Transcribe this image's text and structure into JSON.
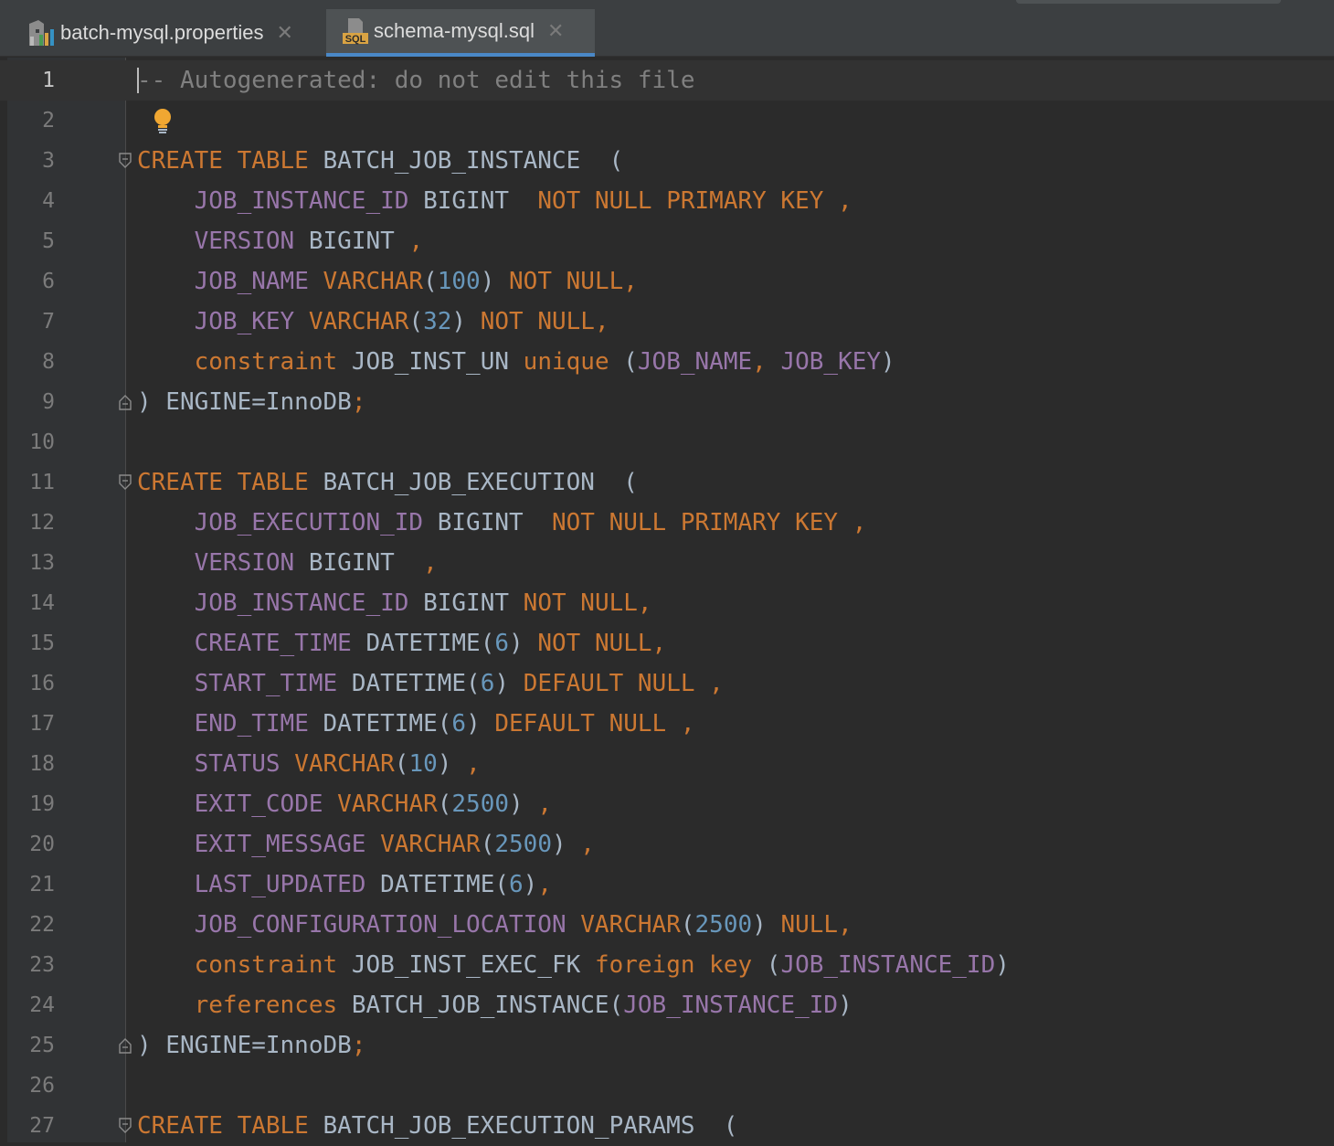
{
  "tabs": [
    {
      "label": "batch-mysql.properties",
      "icon": "properties-file-icon",
      "active": false
    },
    {
      "label": "schema-mysql.sql",
      "icon": "sql-file-icon",
      "active": true
    }
  ],
  "sql_icon_text": "SQL",
  "close_glyph": "✕",
  "colors": {
    "keyword": "#cc7832",
    "column": "#9876aa",
    "number": "#6897bb",
    "identifier": "#a9b7c6",
    "comment": "#808080",
    "background": "#2b2b2b",
    "gutter": "#313335",
    "active_tab_underline": "#4a88c7"
  },
  "editor": {
    "current_line": 1,
    "lines": [
      {
        "n": "1",
        "tokens": [
          {
            "t": "-- Autogenerated: do not edit this file",
            "c": "cmt"
          }
        ]
      },
      {
        "n": "2",
        "tokens": []
      },
      {
        "n": "3",
        "fold": "open",
        "tokens": [
          {
            "t": "CREATE TABLE ",
            "c": "kw"
          },
          {
            "t": "BATCH_JOB_INSTANCE  (",
            "c": "plain"
          }
        ]
      },
      {
        "n": "4",
        "tokens": [
          {
            "t": "    ",
            "c": "plain"
          },
          {
            "t": "JOB_INSTANCE_ID",
            "c": "col"
          },
          {
            "t": " BIGINT  ",
            "c": "plain"
          },
          {
            "t": "NOT NULL PRIMARY KEY ,",
            "c": "kw"
          }
        ]
      },
      {
        "n": "5",
        "tokens": [
          {
            "t": "    ",
            "c": "plain"
          },
          {
            "t": "VERSION",
            "c": "col"
          },
          {
            "t": " BIGINT ",
            "c": "plain"
          },
          {
            "t": ",",
            "c": "kw"
          }
        ]
      },
      {
        "n": "6",
        "tokens": [
          {
            "t": "    ",
            "c": "plain"
          },
          {
            "t": "JOB_NAME",
            "c": "col"
          },
          {
            "t": " ",
            "c": "plain"
          },
          {
            "t": "VARCHAR",
            "c": "kw"
          },
          {
            "t": "(",
            "c": "plain"
          },
          {
            "t": "100",
            "c": "num"
          },
          {
            "t": ") ",
            "c": "plain"
          },
          {
            "t": "NOT NULL,",
            "c": "kw"
          }
        ]
      },
      {
        "n": "7",
        "tokens": [
          {
            "t": "    ",
            "c": "plain"
          },
          {
            "t": "JOB_KEY",
            "c": "col"
          },
          {
            "t": " ",
            "c": "plain"
          },
          {
            "t": "VARCHAR",
            "c": "kw"
          },
          {
            "t": "(",
            "c": "plain"
          },
          {
            "t": "32",
            "c": "num"
          },
          {
            "t": ") ",
            "c": "plain"
          },
          {
            "t": "NOT NULL,",
            "c": "kw"
          }
        ]
      },
      {
        "n": "8",
        "tokens": [
          {
            "t": "    ",
            "c": "plain"
          },
          {
            "t": "constraint",
            "c": "kw"
          },
          {
            "t": " JOB_INST_UN ",
            "c": "plain"
          },
          {
            "t": "unique",
            "c": "kw"
          },
          {
            "t": " (",
            "c": "plain"
          },
          {
            "t": "JOB_NAME",
            "c": "col"
          },
          {
            "t": ", ",
            "c": "kw"
          },
          {
            "t": "JOB_KEY",
            "c": "col"
          },
          {
            "t": ")",
            "c": "plain"
          }
        ]
      },
      {
        "n": "9",
        "fold": "close",
        "tokens": [
          {
            "t": ") ENGINE=InnoDB",
            "c": "plain"
          },
          {
            "t": ";",
            "c": "kw"
          }
        ]
      },
      {
        "n": "10",
        "tokens": []
      },
      {
        "n": "11",
        "fold": "open",
        "tokens": [
          {
            "t": "CREATE TABLE ",
            "c": "kw"
          },
          {
            "t": "BATCH_JOB_EXECUTION  (",
            "c": "plain"
          }
        ]
      },
      {
        "n": "12",
        "tokens": [
          {
            "t": "    ",
            "c": "plain"
          },
          {
            "t": "JOB_EXECUTION_ID",
            "c": "col"
          },
          {
            "t": " BIGINT  ",
            "c": "plain"
          },
          {
            "t": "NOT NULL PRIMARY KEY ,",
            "c": "kw"
          }
        ]
      },
      {
        "n": "13",
        "tokens": [
          {
            "t": "    ",
            "c": "plain"
          },
          {
            "t": "VERSION",
            "c": "col"
          },
          {
            "t": " BIGINT  ",
            "c": "plain"
          },
          {
            "t": ",",
            "c": "kw"
          }
        ]
      },
      {
        "n": "14",
        "tokens": [
          {
            "t": "    ",
            "c": "plain"
          },
          {
            "t": "JOB_INSTANCE_ID",
            "c": "col"
          },
          {
            "t": " BIGINT ",
            "c": "plain"
          },
          {
            "t": "NOT NULL,",
            "c": "kw"
          }
        ]
      },
      {
        "n": "15",
        "tokens": [
          {
            "t": "    ",
            "c": "plain"
          },
          {
            "t": "CREATE_TIME",
            "c": "col"
          },
          {
            "t": " DATETIME(",
            "c": "plain"
          },
          {
            "t": "6",
            "c": "num"
          },
          {
            "t": ") ",
            "c": "plain"
          },
          {
            "t": "NOT NULL,",
            "c": "kw"
          }
        ]
      },
      {
        "n": "16",
        "tokens": [
          {
            "t": "    ",
            "c": "plain"
          },
          {
            "t": "START_TIME",
            "c": "col"
          },
          {
            "t": " DATETIME(",
            "c": "plain"
          },
          {
            "t": "6",
            "c": "num"
          },
          {
            "t": ") ",
            "c": "plain"
          },
          {
            "t": "DEFAULT NULL ,",
            "c": "kw"
          }
        ]
      },
      {
        "n": "17",
        "tokens": [
          {
            "t": "    ",
            "c": "plain"
          },
          {
            "t": "END_TIME",
            "c": "col"
          },
          {
            "t": " DATETIME(",
            "c": "plain"
          },
          {
            "t": "6",
            "c": "num"
          },
          {
            "t": ") ",
            "c": "plain"
          },
          {
            "t": "DEFAULT NULL ,",
            "c": "kw"
          }
        ]
      },
      {
        "n": "18",
        "tokens": [
          {
            "t": "    ",
            "c": "plain"
          },
          {
            "t": "STATUS",
            "c": "col"
          },
          {
            "t": " ",
            "c": "plain"
          },
          {
            "t": "VARCHAR",
            "c": "kw"
          },
          {
            "t": "(",
            "c": "plain"
          },
          {
            "t": "10",
            "c": "num"
          },
          {
            "t": ") ",
            "c": "plain"
          },
          {
            "t": ",",
            "c": "kw"
          }
        ]
      },
      {
        "n": "19",
        "tokens": [
          {
            "t": "    ",
            "c": "plain"
          },
          {
            "t": "EXIT_CODE",
            "c": "col"
          },
          {
            "t": " ",
            "c": "plain"
          },
          {
            "t": "VARCHAR",
            "c": "kw"
          },
          {
            "t": "(",
            "c": "plain"
          },
          {
            "t": "2500",
            "c": "num"
          },
          {
            "t": ") ",
            "c": "plain"
          },
          {
            "t": ",",
            "c": "kw"
          }
        ]
      },
      {
        "n": "20",
        "tokens": [
          {
            "t": "    ",
            "c": "plain"
          },
          {
            "t": "EXIT_MESSAGE",
            "c": "col"
          },
          {
            "t": " ",
            "c": "plain"
          },
          {
            "t": "VARCHAR",
            "c": "kw"
          },
          {
            "t": "(",
            "c": "plain"
          },
          {
            "t": "2500",
            "c": "num"
          },
          {
            "t": ") ",
            "c": "plain"
          },
          {
            "t": ",",
            "c": "kw"
          }
        ]
      },
      {
        "n": "21",
        "tokens": [
          {
            "t": "    ",
            "c": "plain"
          },
          {
            "t": "LAST_UPDATED",
            "c": "col"
          },
          {
            "t": " DATETIME(",
            "c": "plain"
          },
          {
            "t": "6",
            "c": "num"
          },
          {
            "t": ")",
            "c": "plain"
          },
          {
            "t": ",",
            "c": "kw"
          }
        ]
      },
      {
        "n": "22",
        "tokens": [
          {
            "t": "    ",
            "c": "plain"
          },
          {
            "t": "JOB_CONFIGURATION_LOCATION",
            "c": "col"
          },
          {
            "t": " ",
            "c": "plain"
          },
          {
            "t": "VARCHAR",
            "c": "kw"
          },
          {
            "t": "(",
            "c": "plain"
          },
          {
            "t": "2500",
            "c": "num"
          },
          {
            "t": ") ",
            "c": "plain"
          },
          {
            "t": "NULL,",
            "c": "kw"
          }
        ]
      },
      {
        "n": "23",
        "tokens": [
          {
            "t": "    ",
            "c": "plain"
          },
          {
            "t": "constraint",
            "c": "kw"
          },
          {
            "t": " JOB_INST_EXEC_FK ",
            "c": "plain"
          },
          {
            "t": "foreign key",
            "c": "kw"
          },
          {
            "t": " (",
            "c": "plain"
          },
          {
            "t": "JOB_INSTANCE_ID",
            "c": "col"
          },
          {
            "t": ")",
            "c": "plain"
          }
        ]
      },
      {
        "n": "24",
        "tokens": [
          {
            "t": "    ",
            "c": "plain"
          },
          {
            "t": "references",
            "c": "kw"
          },
          {
            "t": " BATCH_JOB_INSTANCE(",
            "c": "plain"
          },
          {
            "t": "JOB_INSTANCE_ID",
            "c": "col"
          },
          {
            "t": ")",
            "c": "plain"
          }
        ]
      },
      {
        "n": "25",
        "fold": "close",
        "tokens": [
          {
            "t": ") ENGINE=InnoDB",
            "c": "plain"
          },
          {
            "t": ";",
            "c": "kw"
          }
        ]
      },
      {
        "n": "26",
        "tokens": []
      },
      {
        "n": "27",
        "fold": "open",
        "tokens": [
          {
            "t": "CREATE TABLE ",
            "c": "kw"
          },
          {
            "t": "BATCH_JOB_EXECUTION_PARAMS  (",
            "c": "plain"
          }
        ]
      }
    ]
  }
}
